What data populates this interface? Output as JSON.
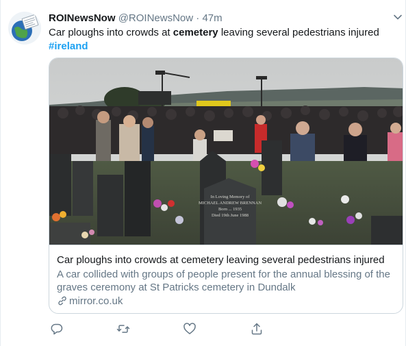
{
  "tweet": {
    "author_name": "ROINewsNow",
    "author_handle": "@ROINewsNow",
    "separator": "·",
    "time": "47m",
    "text_before": "Car ploughs into crowds at ",
    "text_bold": "cemetery",
    "text_after": " leaving several pedestrians injured",
    "hashtag": "#ireland"
  },
  "card": {
    "image_alt": "crowd-at-cemetery-photo",
    "title": "Car ploughs into crowds at cemetery leaving several pedestrians injured",
    "description": "A car collided with groups of people present for the annual blessing of the graves ceremony at St Patricks cemetery in Dundalk",
    "domain": "mirror.co.uk",
    "headstone_text": [
      "In Loving Memory of",
      "MICHAEL ANDREW BRENNAN",
      "Born ... 1935",
      "Died 19th June 1988"
    ]
  },
  "icons": {
    "reply": "reply-icon",
    "retweet": "retweet-icon",
    "like": "like-icon",
    "share": "share-icon",
    "more": "chevron-down-icon",
    "link": "link-icon"
  },
  "colors": {
    "accent": "#1da1f2",
    "secondary_text": "#657786",
    "border": "#ccd6dd"
  }
}
